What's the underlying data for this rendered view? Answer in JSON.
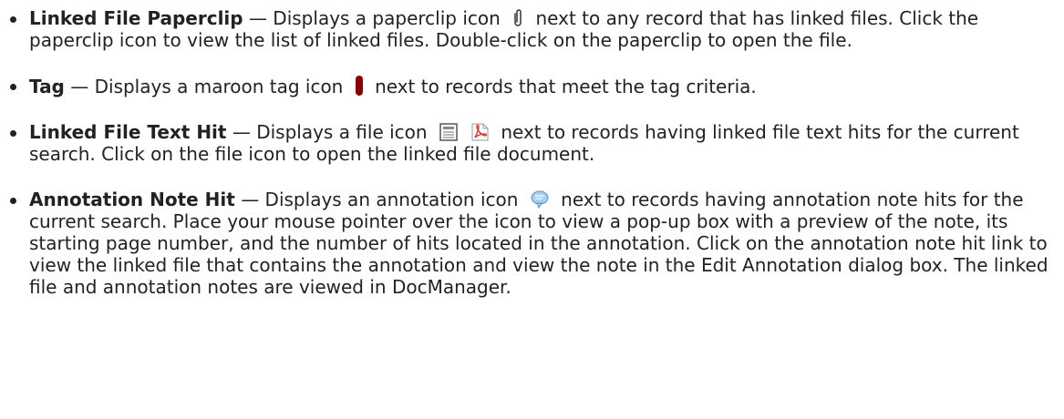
{
  "items": [
    {
      "term": "Linked File Paperclip",
      "before_icon": " — Displays a paperclip icon",
      "after_icon": "next to any record that has linked files. Click the paperclip icon to view the list of linked files. Double-click on the paperclip to open the file.",
      "icons": [
        "paperclip-icon"
      ]
    },
    {
      "term": "Tag",
      "before_icon": " — Displays a maroon tag icon",
      "after_icon": "next to records that meet the tag criteria.",
      "icons": [
        "tag-icon"
      ]
    },
    {
      "term": "Linked File Text Hit",
      "before_icon": " — Displays a file icon",
      "after_icon": "next to records having linked file text hits for the current search. Click on the file icon to open the linked file document.",
      "icons": [
        "file-icon",
        "pdf-icon"
      ]
    },
    {
      "term": "Annotation Note Hit",
      "before_icon": " — Displays an annotation icon",
      "after_icon": "next to records having annotation note hits for the current search. Place your mouse pointer over the icon to view a pop-up box with a preview of the note, its starting page number, and the number of hits located in the annotation. Click on the annotation note hit link to view the linked file that contains the annotation and view the note in the Edit Annotation dialog box. The linked file and annotation notes are viewed in DocManager.",
      "icons": [
        "annotation-icon"
      ]
    }
  ],
  "colors": {
    "text": "#222222",
    "tag": "#8b0000",
    "pdf": "#d9342b",
    "annotation": "#6aa8d8"
  }
}
